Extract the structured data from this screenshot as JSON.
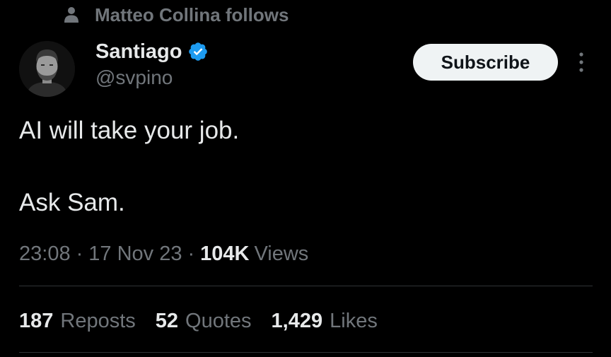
{
  "social_context": {
    "icon": "person-icon",
    "text": "Matteo Collina follows"
  },
  "author": {
    "name": "Santiago",
    "handle": "@svpino",
    "verified": true,
    "verified_color": "#1d9bf0",
    "avatar_icon": "avatar-photo"
  },
  "actions": {
    "subscribe_label": "Subscribe",
    "more_icon": "more-vertical-icon"
  },
  "tweet": {
    "lines": [
      "AI will take your job.",
      "Ask Sam."
    ]
  },
  "meta": {
    "time": "23:08",
    "separator": "·",
    "date": "17 Nov 23",
    "views_count": "104K",
    "views_label": "Views"
  },
  "engagement": {
    "reposts": {
      "count": "187",
      "label": "Reposts"
    },
    "quotes": {
      "count": "52",
      "label": "Quotes"
    },
    "likes": {
      "count": "1,429",
      "label": "Likes"
    }
  },
  "colors": {
    "background": "#000000",
    "text_primary": "#e7e9ea",
    "text_secondary": "#71767b",
    "divider": "#2f3336",
    "button_bg": "#eff3f4",
    "button_text": "#0f1419"
  }
}
